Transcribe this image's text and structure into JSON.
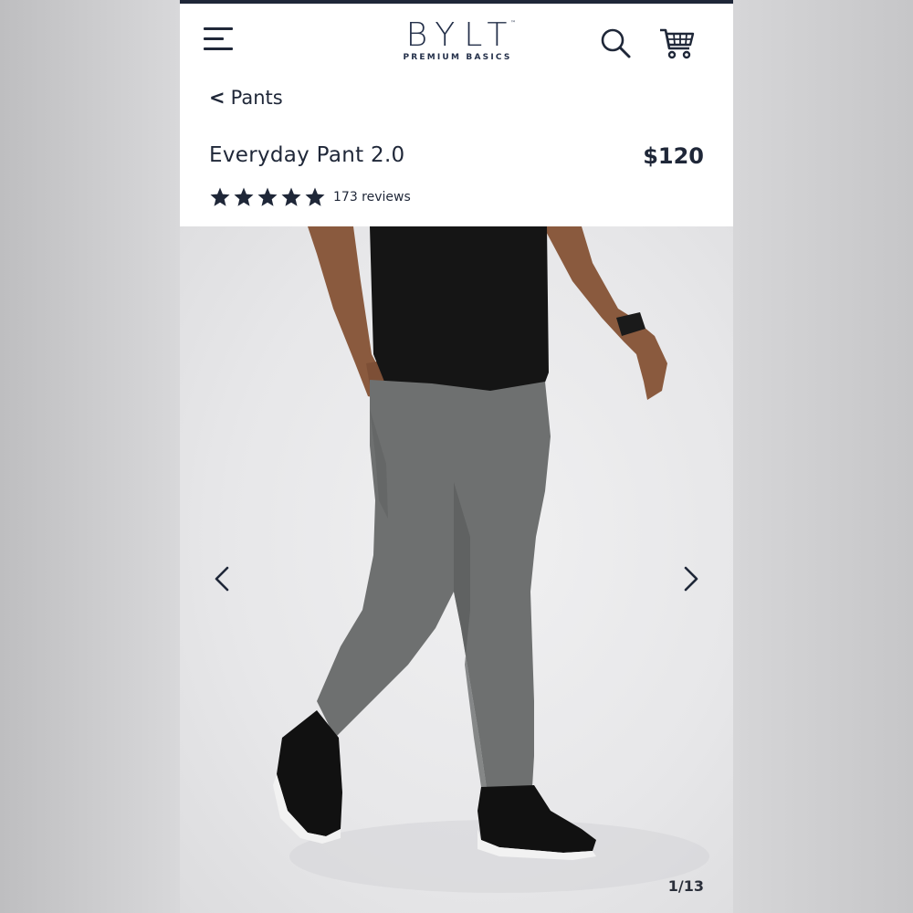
{
  "brand": {
    "name": "BYLT",
    "trademark": "™",
    "tagline": "PREMIUM BASICS",
    "color": "#24304a"
  },
  "header": {
    "menu_icon": "hamburger-menu-icon",
    "search_icon": "search-icon",
    "cart_icon": "cart-icon"
  },
  "breadcrumb": {
    "back_icon": "chevron-left-icon",
    "label": "Pants"
  },
  "product": {
    "title": "Everyday Pant 2.0",
    "price": "$120",
    "rating": 5,
    "rating_max": 5,
    "reviews_label": "173 reviews"
  },
  "gallery": {
    "counter": "1/13",
    "prev_icon": "chevron-left-icon",
    "next_icon": "chevron-right-icon",
    "current_index": 1,
    "total": 13
  },
  "colors": {
    "accent": "#1f2738",
    "pant": "#6e7070",
    "shirt": "#151515",
    "background": "#ebebed"
  }
}
